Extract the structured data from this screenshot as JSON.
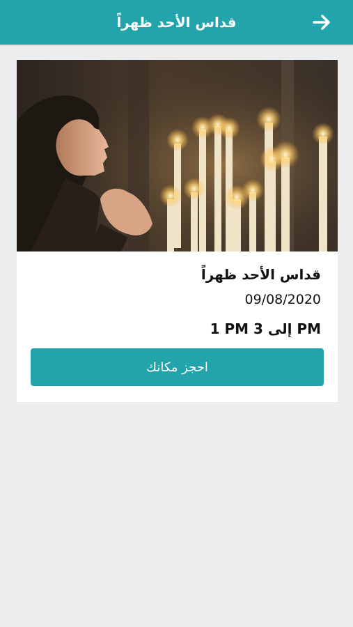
{
  "header": {
    "title": "قداس الأحد ظهراً",
    "back_icon": "arrow-right-icon",
    "color": "#23a4ac"
  },
  "event": {
    "title": "قداس الأحد ظهراً",
    "date": "09/08/2020",
    "time_range": "1 PM إلى 3 PM",
    "image_icon": "praying-woman-candles-image"
  },
  "book_button": {
    "label": "احجز مكانك",
    "color": "#23a4ac"
  }
}
